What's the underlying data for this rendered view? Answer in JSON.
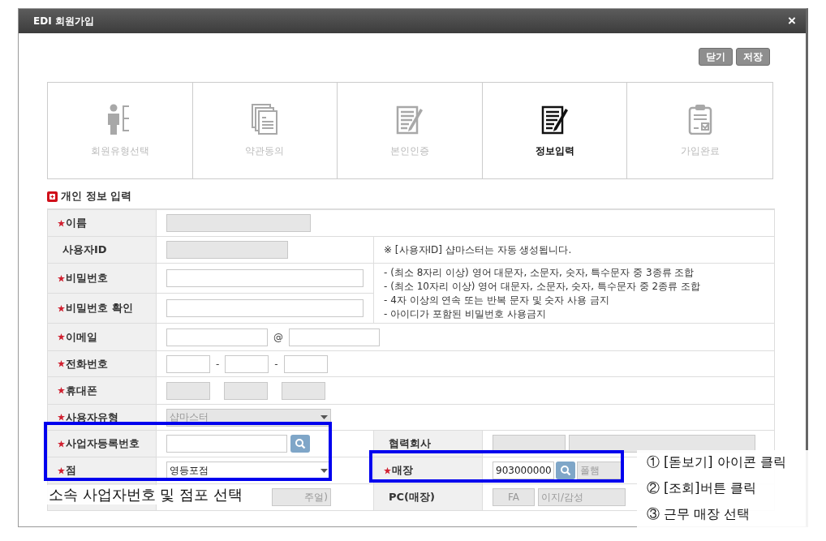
{
  "window": {
    "title": "EDI 회원가입",
    "close": "×"
  },
  "buttons": [
    {
      "label": "닫기"
    },
    {
      "label": "저장"
    }
  ],
  "steps": [
    {
      "label": "회원유형선택",
      "selected": false
    },
    {
      "label": "약관동의",
      "selected": false
    },
    {
      "label": "본인인증",
      "selected": false
    },
    {
      "label": "정보입력",
      "selected": true
    },
    {
      "label": "가입완료",
      "selected": false
    }
  ],
  "section": {
    "title": "개인 정보 입력"
  },
  "form": {
    "name": {
      "label": "이름",
      "required": true
    },
    "user_id": {
      "label": "사용자ID",
      "required": false,
      "note": "※ [사용자ID] 샵마스터는 자동 생성됩니다."
    },
    "password": {
      "label": "비밀번호",
      "required": true
    },
    "password_confirm": {
      "label": "비밀번호 확인",
      "required": true
    },
    "password_rules": [
      "- (최소 8자리 이상) 영어 대문자, 소문자, 숫자, 특수문자 중 3종류 조합",
      "- (최소 10자리 이상) 영어 대문자, 소문자, 숫자, 특수문자 중 2종류 조합",
      "- 4자 이상의 연속 또는 반복 문자 및 숫자 사용 금지",
      "- 아이디가 포함된 비밀번호 사용금지"
    ],
    "email": {
      "label": "이메일",
      "required": true,
      "separator": "@"
    },
    "phone": {
      "label": "전화번호",
      "required": true,
      "separators": [
        "-",
        "-"
      ]
    },
    "mobile": {
      "label": "휴대폰",
      "required": true
    },
    "user_type": {
      "label": "사용자유형",
      "required": true,
      "value": "샵마스터"
    },
    "business_number": {
      "label": "사업자등록번호",
      "required": true
    },
    "partner": {
      "label": "협력회사",
      "required": false
    },
    "branch": {
      "label": "점",
      "required": true,
      "value": "영등포점"
    },
    "store": {
      "label": "매장",
      "required": true,
      "code": "903000000",
      "name": "폴햄"
    },
    "team": {
      "value": "주얼)"
    },
    "pc": {
      "label": "PC(매장)",
      "required": false,
      "values": [
        "FA",
        "이지/감성"
      ]
    }
  },
  "annotations": {
    "caption": "소속 사업자번호 및 점포 선택",
    "instructions": [
      "① [돋보기] 아이콘 클릭",
      "② [조회]버튼 클릭",
      "③ 근무 매장 선택"
    ]
  }
}
